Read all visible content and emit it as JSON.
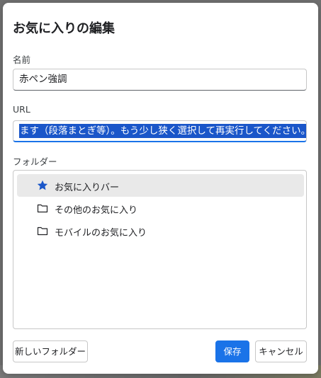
{
  "dialog": {
    "title": "お気に入りの編集",
    "name_label": "名前",
    "name_value": "赤ペン強調",
    "url_label": "URL",
    "url_value_visible": "ます（段落まとぎ等）。もう少し狭く選択して再実行してください。\")}})();",
    "folder_label": "フォルダー",
    "folders": [
      {
        "label": "お気に入りバー",
        "icon": "star-icon",
        "selected": true
      },
      {
        "label": "その他のお気に入り",
        "icon": "folder-icon",
        "selected": false
      },
      {
        "label": "モバイルのお気に入り",
        "icon": "folder-icon",
        "selected": false
      }
    ],
    "buttons": {
      "new_folder": "新しいフォルダー",
      "save": "保存",
      "cancel": "キャンセル"
    }
  },
  "colors": {
    "accent": "#1a73e8",
    "selection": "#1a56c9",
    "star": "#1a56c9",
    "selected_row": "#e9e9e9"
  }
}
